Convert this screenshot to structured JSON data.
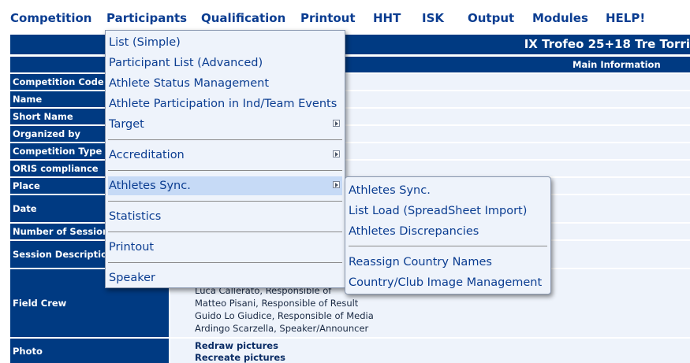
{
  "menubar": {
    "items": [
      {
        "label": "Competition"
      },
      {
        "label": "Participants"
      },
      {
        "label": "Qualification"
      },
      {
        "label": "Printout"
      },
      {
        "label": "HHT"
      },
      {
        "label": "ISK"
      },
      {
        "label": "Output"
      },
      {
        "label": "Modules"
      },
      {
        "label": "HELP!"
      }
    ]
  },
  "competition": {
    "title": "IX Trofeo 25+18 Tre Torri",
    "section_header": "Main Information",
    "labels": [
      "Competition Code",
      "Name",
      "Short Name",
      "Organized by",
      "Competition Type",
      "ORIS compliance",
      "Place",
      "Date",
      "Number of Sessions",
      "Session Description",
      "Field Crew",
      "Photo"
    ],
    "field_crew": [
      "Luca Callerato, Responsible of",
      "Matteo Pisani, Responsible of Result",
      "Guido Lo Giudice, Responsible of Media",
      "Ardingo Scarzella, Speaker/Announcer"
    ],
    "photo_actions": [
      "Redraw pictures",
      "Recreate pictures"
    ]
  },
  "participants_menu": {
    "items": [
      {
        "label": "List (Simple)"
      },
      {
        "label": "Participant List (Advanced)"
      },
      {
        "label": "Athlete Status Management"
      },
      {
        "label": "Athlete Participation in Ind/Team Events"
      },
      {
        "label": "Target"
      },
      {
        "label": "Accreditation"
      },
      {
        "label": "Athletes Sync."
      },
      {
        "label": "Statistics"
      },
      {
        "label": "Printout"
      },
      {
        "label": "Speaker"
      }
    ]
  },
  "athletes_sync_submenu": {
    "items": [
      {
        "label": "Athletes Sync."
      },
      {
        "label": "List Load (SpreadSheet Import)"
      },
      {
        "label": "Athletes Discrepancies"
      },
      {
        "label": "Reassign Country Names"
      },
      {
        "label": "Country/Club Image Management"
      }
    ]
  }
}
